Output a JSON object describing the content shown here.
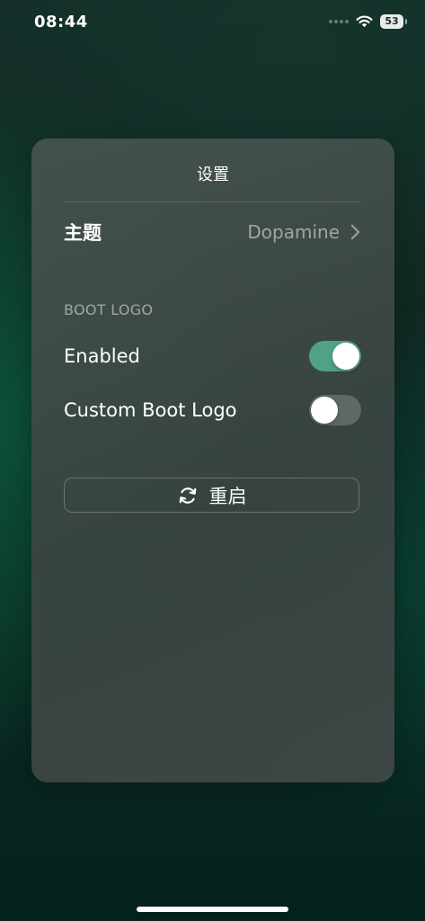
{
  "status_bar": {
    "time": "08:44",
    "battery_level": "53",
    "icons": [
      "cellular-signal-icon",
      "wifi-icon",
      "battery-icon"
    ]
  },
  "settings": {
    "title": "设置",
    "theme": {
      "label": "主题",
      "value": "Dopamine",
      "icon": "chevron-right-icon"
    },
    "boot_logo": {
      "section_header": "BOOT LOGO",
      "enabled": {
        "label": "Enabled",
        "state": true
      },
      "custom_boot_logo": {
        "label": "Custom Boot Logo",
        "state": false
      }
    },
    "restart_button": {
      "label": "重启",
      "icon": "refresh-icon"
    }
  },
  "colors": {
    "toggle_on": "#4fa283",
    "toggle_off": "#5e6866",
    "card_background": "#3f4a48",
    "secondary_text": "#9aa3a1"
  }
}
